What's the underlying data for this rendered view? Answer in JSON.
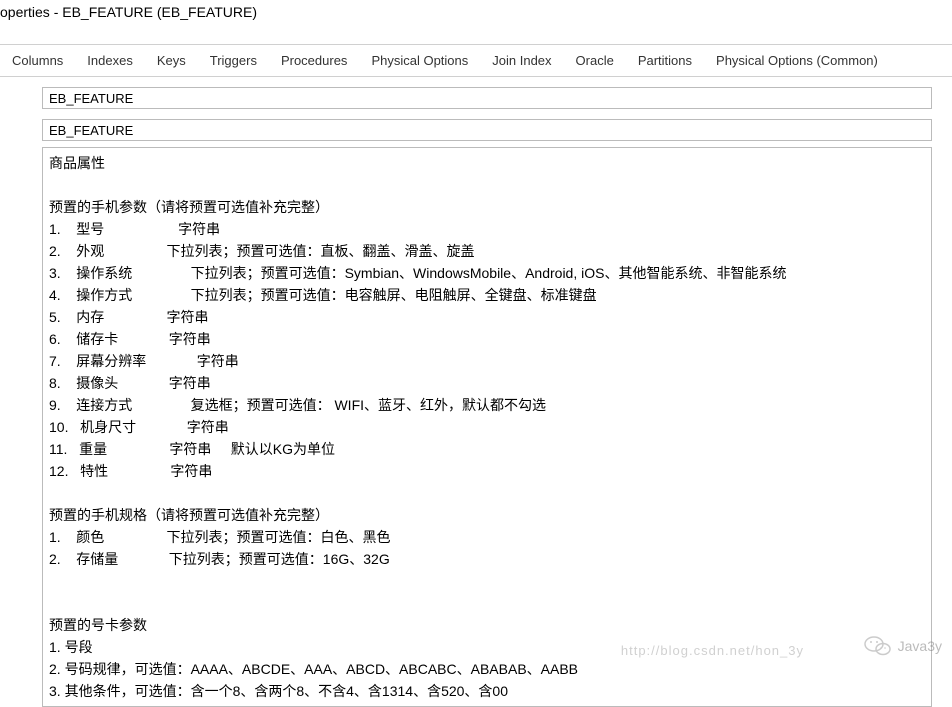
{
  "title": "operties - EB_FEATURE (EB_FEATURE)",
  "tabs": [
    "Columns",
    "Indexes",
    "Keys",
    "Triggers",
    "Procedures",
    "Physical Options",
    "Join Index",
    "Oracle",
    "Partitions",
    "Physical Options (Common)"
  ],
  "field_name": "EB_FEATURE",
  "field_code": "EB_FEATURE",
  "description": {
    "header": "商品属性",
    "params_heading": "预置的手机参数（请将预置可选值补充完整）",
    "params": [
      "1.    型号                   字符串",
      "2.    外观                下拉列表；预置可选值：直板、翻盖、滑盖、旋盖",
      "3.    操作系统               下拉列表；预置可选值：Symbian、WindowsMobile、Android, iOS、其他智能系统、非智能系统",
      "4.    操作方式               下拉列表；预置可选值：电容触屏、电阻触屏、全键盘、标准键盘",
      "5.    内存                字符串",
      "6.    储存卡             字符串",
      "7.    屏幕分辨率             字符串",
      "8.    摄像头             字符串",
      "9.    连接方式               复选框；预置可选值： WIFI、蓝牙、红外，默认都不勾选",
      "10.   机身尺寸             字符串",
      "11.   重量                字符串     默认以KG为单位",
      "12.   特性                字符串"
    ],
    "specs_heading": "预置的手机规格（请将预置可选值补充完整）",
    "specs": [
      "1.    颜色                下拉列表；预置可选值：白色、黑色",
      "2.    存储量             下拉列表；预置可选值：16G、32G"
    ],
    "card_heading": "预置的号卡参数",
    "card": [
      "1. 号段",
      "2. 号码规律，可选值：AAAA、ABCDE、AAA、ABCD、ABCABC、ABABAB、AABB",
      "3. 其他条件，可选值：含一个8、含两个8、不含4、含1314、含520、含00"
    ]
  },
  "watermark_text": "Java3y",
  "watermark_url": "http://blog.csdn.net/hon_3y"
}
